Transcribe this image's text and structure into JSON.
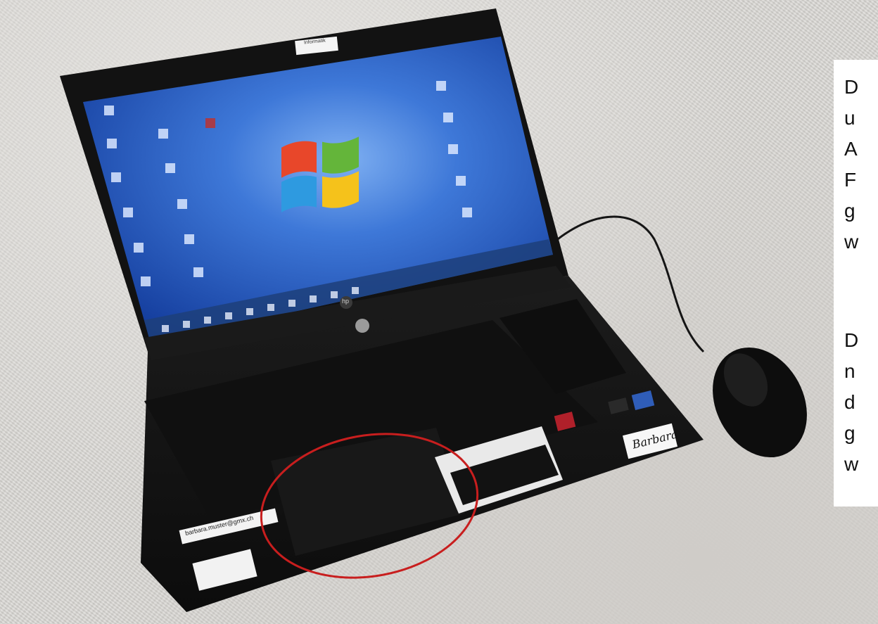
{
  "text_lines": {
    "para1": [
      "D",
      "u",
      "A",
      "F",
      "g",
      "w"
    ],
    "para2": [
      "D",
      "n",
      "d",
      "g",
      "w"
    ]
  },
  "laptop": {
    "lid_sticker": "Informatik",
    "email_label": "barbara.muster@gmx.ch",
    "name_sticker": "Barbara",
    "brand_logo": "hp"
  },
  "colors": {
    "desktop": "#2f63c9",
    "highlight_circle": "#c81e1e",
    "laptop_body": "#141414",
    "carpet": "#d8d6d2"
  },
  "icons": [
    "windows-logo-icon",
    "mouse-icon",
    "hp-logo-icon"
  ]
}
